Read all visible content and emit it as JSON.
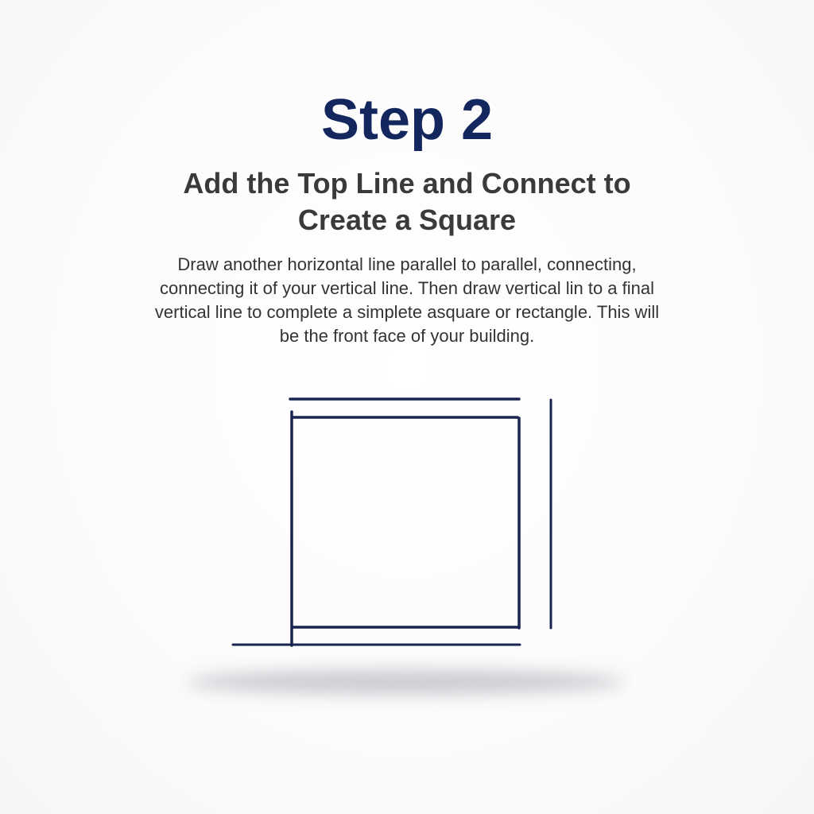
{
  "step": {
    "title": "Step 2",
    "subtitle_lines": [
      "Add the Top Line and Connect to",
      "Create a Square"
    ],
    "body_lines": [
      "Draw another horizontal line parallel to parallel, connecting,",
      "connecting it of your vertical line. Then draw vertical lin to a final",
      "vertical line to complete a simplete asquare or rectangle. This will",
      "be the front face of your building."
    ]
  },
  "colors": {
    "title": "#13275e",
    "text": "#333333",
    "stroke": "#1a2450",
    "shadow": "#c9cbcf"
  }
}
